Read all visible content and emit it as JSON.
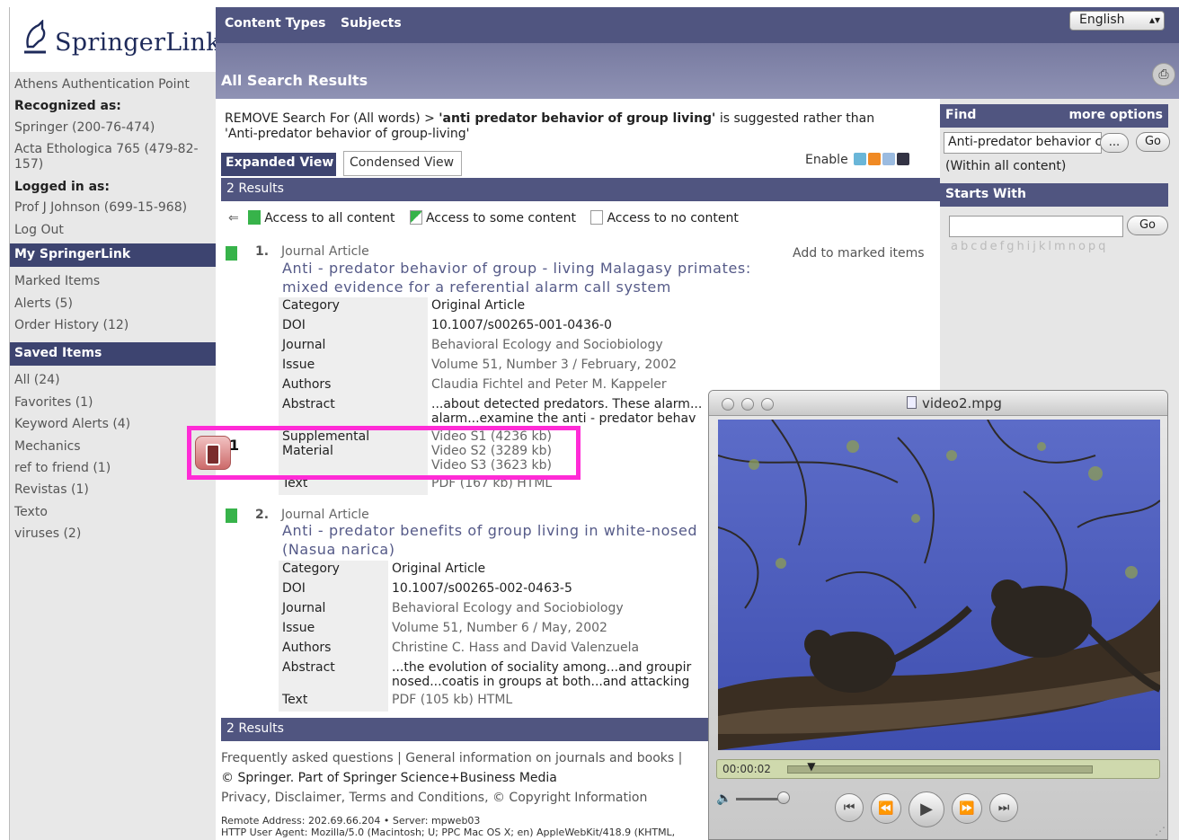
{
  "sidebar": {
    "logo": "SpringerLink",
    "athens": "Athens Authentication Point",
    "recognized_label": "Recognized as:",
    "recognized": [
      "Springer (200-76-474)",
      "Acta Ethologica 765 (479-82-157)"
    ],
    "logged_label": "Logged in as:",
    "user": "Prof J Johnson (699-15-968)",
    "logout": "Log Out",
    "my_head": "My SpringerLink",
    "my_items": [
      "Marked Items",
      "Alerts (5)",
      "Order History (12)"
    ],
    "saved_head": "Saved Items",
    "saved_items": [
      "All (24)",
      "Favorites (1)",
      "Keyword Alerts (4)",
      "Mechanics",
      "ref to friend (1)",
      "Revistas (1)",
      "Texto",
      "viruses (2)"
    ]
  },
  "topbar": {
    "nav": [
      "Content Types",
      "Subjects"
    ],
    "language": "English",
    "page_title": "All Search Results"
  },
  "search": {
    "remove": "REMOVE",
    "search_for": "Search For (All words) >",
    "suggested": "'anti predator behavior of group living'",
    "suggest_rest": "is suggested rather than",
    "original": "'Anti-predator behavior of group-living'",
    "tab_expanded": "Expanded View",
    "tab_condensed": "Condensed View",
    "enable": "Enable",
    "results_count": "2 Results",
    "legend": [
      "Access to all content",
      "Access to some content",
      "Access to no content"
    ],
    "add_marked": "Add to marked items"
  },
  "results": [
    {
      "num": "1.",
      "type": "Journal Article",
      "title_line1": "Anti - predator  behavior  of  group - living  Malagasy  primates:",
      "title_line2": "mixed evidence for a referential alarm call system",
      "meta": [
        {
          "k": "Category",
          "v": "Original Article"
        },
        {
          "k": "DOI",
          "v": "10.1007/s00265-001-0436-0"
        },
        {
          "k": "Journal",
          "v": "Behavioral Ecology and Sociobiology"
        },
        {
          "k": "Issue",
          "v": "Volume 51, Number 3 / February, 2002"
        },
        {
          "k": "Authors",
          "v": "Claudia Fichtel and Peter M. Kappeler"
        },
        {
          "k": "Abstract",
          "v": "...about detected predators. These alarm...",
          "v2": "alarm...examine the anti - predator  behav"
        },
        {
          "k": "Supplemental Material",
          "v": "Video S1 (4236 kb)",
          "v2": "Video S2 (3289 kb)",
          "v3": "Video S3 (3623 kb)"
        },
        {
          "k": "Text",
          "v": "PDF (167 kb)  HTML"
        }
      ]
    },
    {
      "num": "2.",
      "type": "Journal Article",
      "title_line1": "Anti - predator  benefits  of  group  living  in  white-nosed",
      "title_line2": "(Nasua narica)",
      "meta": [
        {
          "k": "Category",
          "v": "Original Article"
        },
        {
          "k": "DOI",
          "v": "10.1007/s00265-002-0463-5"
        },
        {
          "k": "Journal",
          "v": "Behavioral Ecology and Sociobiology"
        },
        {
          "k": "Issue",
          "v": "Volume 51, Number 6 / May, 2002"
        },
        {
          "k": "Authors",
          "v": "Christine C. Hass and David Valenzuela"
        },
        {
          "k": "Abstract",
          "v": "...the evolution  of sociality among...and groupir",
          "v2": "nosed...coatis in groups at both...and attacking"
        },
        {
          "k": "Text",
          "v": "PDF (105 kb)  HTML"
        }
      ]
    }
  ],
  "footer": {
    "line1": "Frequently asked questions | General information on journals and books |",
    "line2": "© Springer. Part of Springer Science+Business Media",
    "line3": "Privacy, Disclaimer, Terms and Conditions, © Copyright Information",
    "line4": "Remote Address: 202.69.66.204 • Server: mpweb03",
    "line5": "HTTP User Agent: Mozilla/5.0 (Macintosh; U; PPC Mac OS X; en) AppleWebKit/418.9 (KHTML,"
  },
  "right": {
    "find": "Find",
    "more_options": "more options",
    "find_value": "Anti-predator behavior c",
    "browse_btn": "...",
    "go": "Go",
    "within": "(Within all content)",
    "starts_with": "Starts With",
    "alphabet": "abcdefghijklmnopq"
  },
  "annotation": {
    "number": "1"
  },
  "quicktime": {
    "title": "video2.mpg",
    "timecode": "00:00:02",
    "progress_fraction": 0.08
  },
  "colors": {
    "nav_dark": "#3d4470",
    "nav_mid": "#505580",
    "access_green": "#37b34a",
    "highlight_magenta": "#ff2bd6",
    "link_blue_gray": "#555a88"
  }
}
